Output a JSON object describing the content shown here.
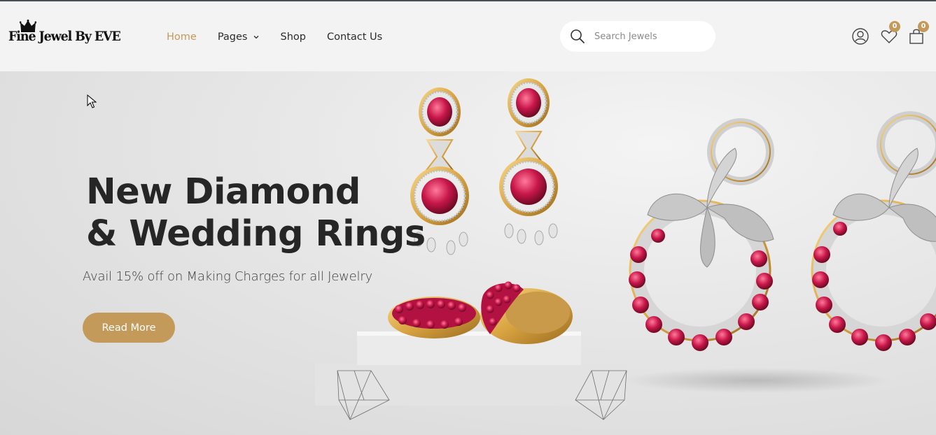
{
  "brand": {
    "logo_text": "Fine Jewel By EVE"
  },
  "nav": {
    "items": [
      {
        "label": "Home",
        "active": true
      },
      {
        "label": "Pages",
        "dropdown": true
      },
      {
        "label": "Shop"
      },
      {
        "label": "Contact Us"
      }
    ]
  },
  "search": {
    "placeholder": "Search Jewels",
    "value": ""
  },
  "header_icons": {
    "account_icon": "user-circle-icon",
    "wishlist_icon": "heart-icon",
    "wishlist_count": "0",
    "cart_icon": "shopping-bag-icon",
    "cart_count": "0"
  },
  "hero": {
    "title": "New Diamond\n& Wedding Rings",
    "subtitle": "Avail 15% off on Making Charges for all Jewelry",
    "button_label": "Read More"
  },
  "colors": {
    "accent": "#c49a5a",
    "text_dark": "#262626",
    "header_bg": "#f3f3f3",
    "ruby": "#c8174a",
    "gold": "#d9a441"
  }
}
